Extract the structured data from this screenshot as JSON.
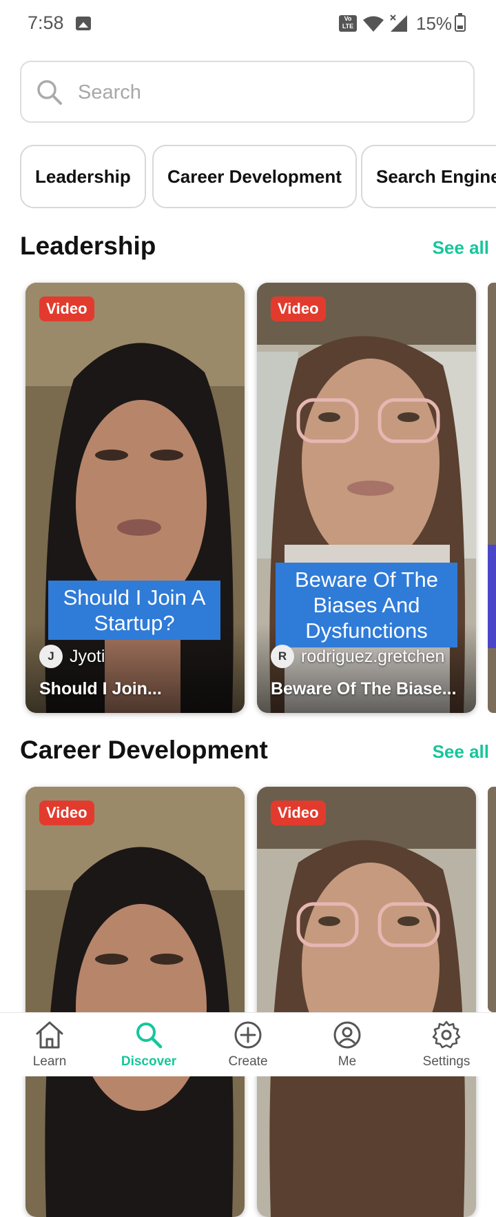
{
  "status_bar": {
    "time": "7:58",
    "network_label": "Vo LTE",
    "battery": "15%"
  },
  "search": {
    "placeholder": "Search"
  },
  "chips": [
    "Leadership",
    "Career Development",
    "Search Engine"
  ],
  "sections": [
    {
      "title": "Leadership",
      "see_all": "See all",
      "cards": [
        {
          "badge": "Video",
          "caption": "Should I Join A Startup?",
          "author_initial": "J",
          "author": "Jyoti",
          "title": "Should I Join..."
        },
        {
          "badge": "Video",
          "caption": "Beware Of The Biases And Dysfunctions",
          "author_initial": "R",
          "author": "rodriguez.gretchen",
          "title": "Beware Of The Biase..."
        }
      ]
    },
    {
      "title": "Career Development",
      "see_all": "See all",
      "cards": [
        {
          "badge": "Video"
        },
        {
          "badge": "Video"
        }
      ]
    }
  ],
  "bottom_nav": [
    {
      "label": "Learn",
      "icon": "home-icon"
    },
    {
      "label": "Discover",
      "icon": "search-icon",
      "active": true
    },
    {
      "label": "Create",
      "icon": "plus-circle-icon"
    },
    {
      "label": "Me",
      "icon": "user-circle-icon"
    },
    {
      "label": "Settings",
      "icon": "gear-icon"
    }
  ],
  "colors": {
    "accent": "#16c69b",
    "badge": "#e23b2e",
    "caption": "#2f7bd8"
  }
}
